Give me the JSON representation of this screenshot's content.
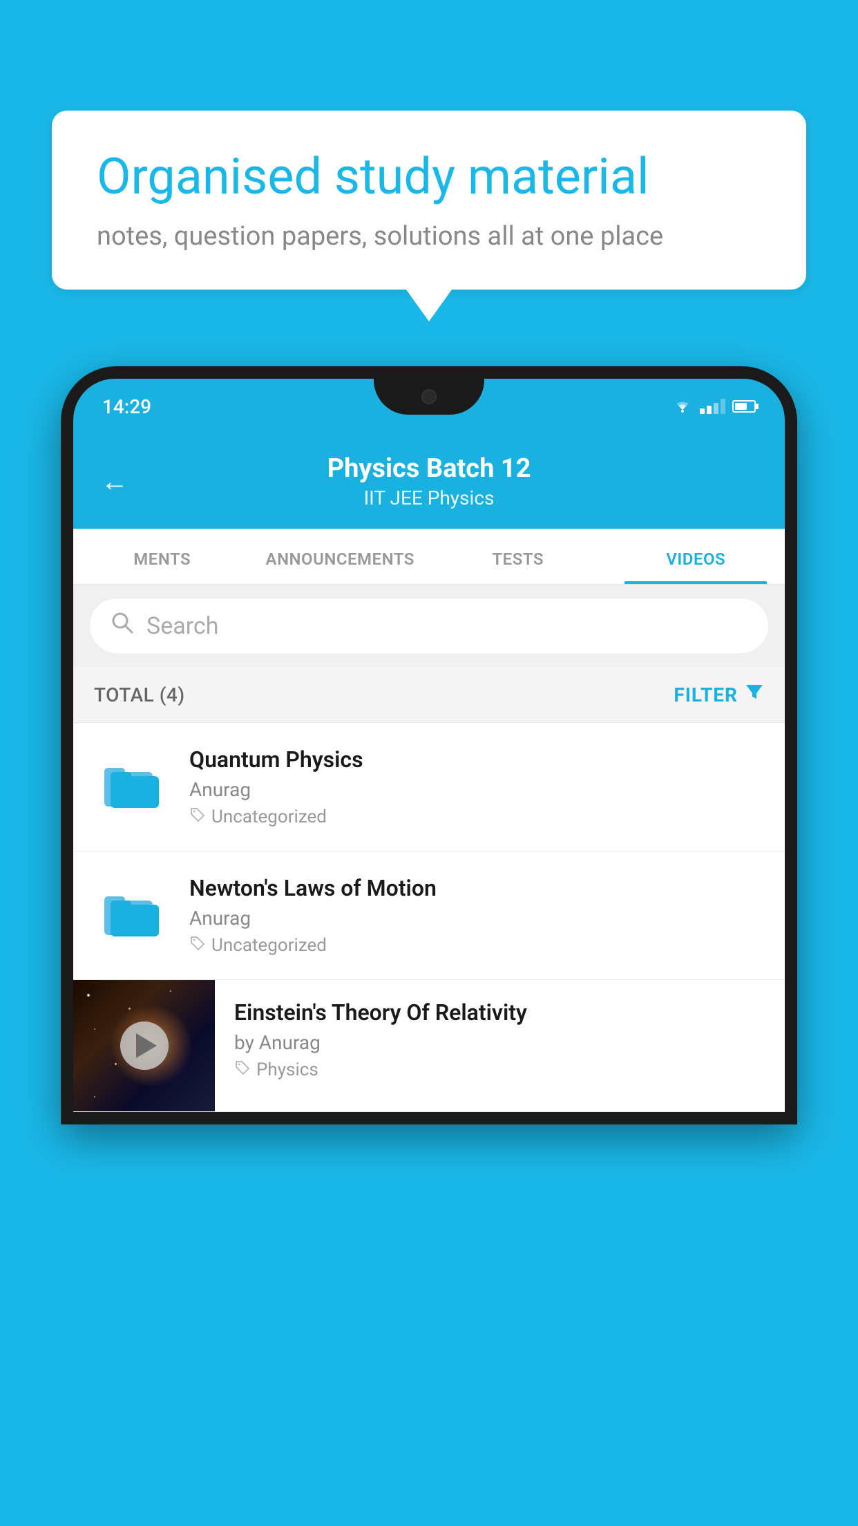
{
  "background_color": "#1ab8e8",
  "speech_bubble": {
    "title": "Organised study material",
    "subtitle": "notes, question papers, solutions all at one place"
  },
  "status_bar": {
    "time": "14:29"
  },
  "app_header": {
    "title": "Physics Batch 12",
    "subtitle": "IIT JEE    Physics",
    "back_label": "←"
  },
  "tabs": [
    {
      "label": "MENTS",
      "active": false
    },
    {
      "label": "ANNOUNCEMENTS",
      "active": false
    },
    {
      "label": "TESTS",
      "active": false
    },
    {
      "label": "VIDEOS",
      "active": true
    }
  ],
  "search": {
    "placeholder": "Search"
  },
  "filter_bar": {
    "total_label": "TOTAL (4)",
    "filter_label": "FILTER"
  },
  "videos": [
    {
      "title": "Quantum Physics",
      "author": "Anurag",
      "tag": "Uncategorized",
      "type": "folder"
    },
    {
      "title": "Newton's Laws of Motion",
      "author": "Anurag",
      "tag": "Uncategorized",
      "type": "folder"
    },
    {
      "title": "Einstein's Theory Of Relativity",
      "author": "by Anurag",
      "tag": "Physics",
      "type": "video"
    }
  ]
}
